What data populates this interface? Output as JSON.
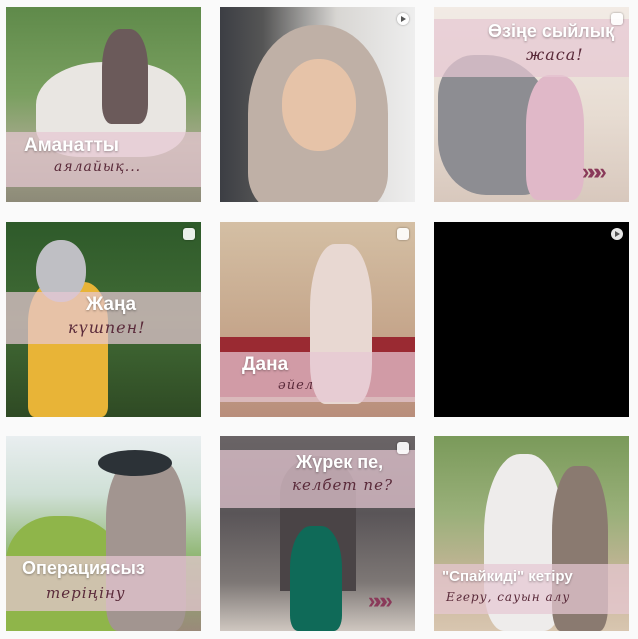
{
  "tiles": [
    {
      "title": "Аманатты",
      "subtitle": "аялайық..."
    },
    {
      "title": "",
      "subtitle": ""
    },
    {
      "title": "Өзіңе сыйлық",
      "subtitle": "жаса!"
    },
    {
      "title": "Жаңа",
      "subtitle": "күшпен!"
    },
    {
      "title": "Дана",
      "subtitle": "әйел"
    },
    {
      "title": "",
      "subtitle": ""
    },
    {
      "title": "Операциясыз",
      "subtitle": "теріңіну"
    },
    {
      "title": "Жүрек пе,",
      "subtitle": "келбет пе?"
    },
    {
      "title": "\"Спайкиді\" кетіру",
      "subtitle": "Егеру, сауын алу"
    }
  ],
  "colors": {
    "accent": "#8a3a5a",
    "band": "#e6c8d2",
    "background": "#fafafa"
  },
  "icons": {
    "chevrons": "»»»",
    "multi_badge": "carousel-icon",
    "video_badge": "video-icon"
  }
}
